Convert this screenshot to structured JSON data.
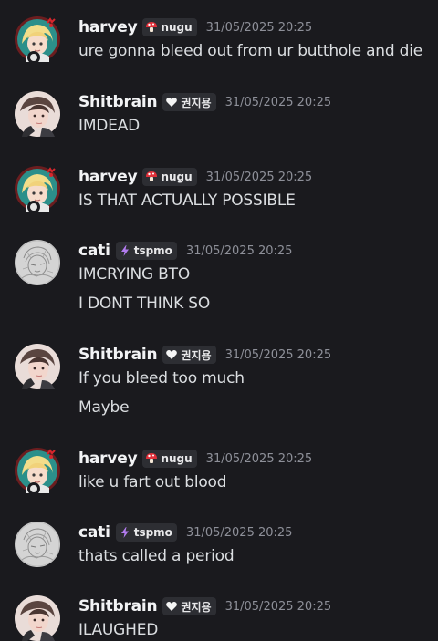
{
  "messages": [
    {
      "user": "harvey",
      "tag": "nugu",
      "tag_icon": "mushroom-icon",
      "timestamp": "31/05/2025 20:25",
      "lines": [
        "ure gonna bleed out from ur butthole and die"
      ]
    },
    {
      "user": "Shitbrain",
      "tag": "권지용",
      "tag_icon": "heart-icon",
      "timestamp": "31/05/2025 20:25",
      "lines": [
        "IMDEAD"
      ]
    },
    {
      "user": "harvey",
      "tag": "nugu",
      "tag_icon": "mushroom-icon",
      "timestamp": "31/05/2025 20:25",
      "lines": [
        "IS THAT ACTUALLY POSSIBLE"
      ]
    },
    {
      "user": "cati",
      "tag": "tspmo",
      "tag_icon": "lightning-icon",
      "timestamp": "31/05/2025 20:25",
      "lines": [
        "IMCRYING BTO",
        "I DONT THINK SO"
      ]
    },
    {
      "user": "Shitbrain",
      "tag": "권지용",
      "tag_icon": "heart-icon",
      "timestamp": "31/05/2025 20:25",
      "lines": [
        "If you bleed too much",
        "Maybe"
      ]
    },
    {
      "user": "harvey",
      "tag": "nugu",
      "tag_icon": "mushroom-icon",
      "timestamp": "31/05/2025 20:25",
      "lines": [
        "like u fart out blood"
      ]
    },
    {
      "user": "cati",
      "tag": "tspmo",
      "tag_icon": "lightning-icon",
      "timestamp": "31/05/2025 20:25",
      "lines": [
        "thats called a period"
      ]
    },
    {
      "user": "Shitbrain",
      "tag": "권지용",
      "tag_icon": "heart-icon",
      "timestamp": "31/05/2025 20:25",
      "lines": [
        "ILAUGHED"
      ]
    }
  ],
  "colors": {
    "background": "#1a1a1e",
    "username": "#f2f3f5",
    "message_text": "#dbdee1",
    "timestamp": "#8e9099",
    "tag_background": "#2d2e33"
  }
}
